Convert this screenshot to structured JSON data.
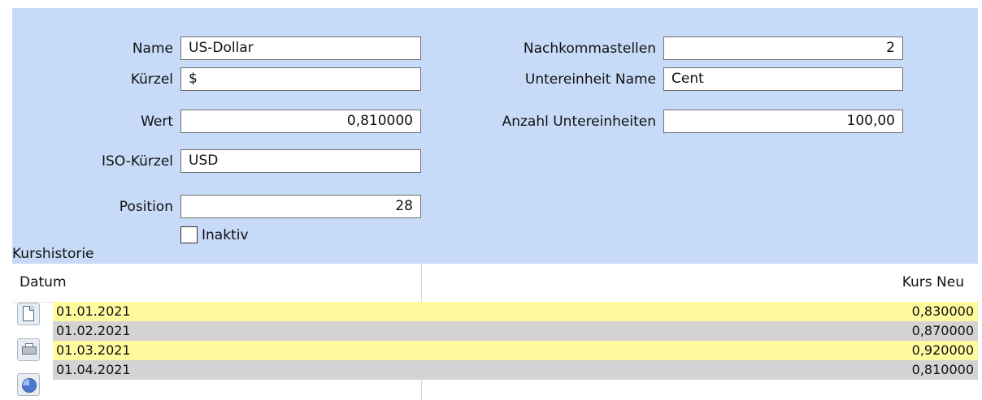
{
  "form": {
    "name_label": "Name",
    "name_value": "US-Dollar",
    "abbreviation_label": "Kürzel",
    "abbreviation_value": "$",
    "value_label": "Wert",
    "value_value": "0,810000",
    "iso_label": "ISO-Kürzel",
    "iso_value": "USD",
    "position_label": "Position",
    "position_value": "28",
    "inactive_label": "Inaktiv",
    "inactive_checked": false,
    "decimals_label": "Nachkommastellen",
    "decimals_value": "2",
    "subunit_name_label": "Untereinheit Name",
    "subunit_name_value": "Cent",
    "subunit_count_label": "Anzahl Untereinheiten",
    "subunit_count_value": "100,00"
  },
  "history": {
    "title": "Kurshistorie",
    "columns": {
      "date": "Datum",
      "rate": "Kurs Neu"
    },
    "rows": [
      {
        "date": "01.01.2021",
        "rate": "0,830000",
        "color": "#fffa9e"
      },
      {
        "date": "01.02.2021",
        "rate": "0,870000",
        "color": "#d3d3d3"
      },
      {
        "date": "01.03.2021",
        "rate": "0,920000",
        "color": "#fffa9e"
      },
      {
        "date": "01.04.2021",
        "rate": "0,810000",
        "color": "#d3d3d3"
      }
    ]
  },
  "toolbar": {
    "icons": [
      "new-document-icon",
      "printer-icon",
      "chart-icon"
    ]
  },
  "colors": {
    "panel_background": "#c7dbf8",
    "yellow_row": "#fffa9e",
    "gray_row": "#d3d3d3"
  }
}
